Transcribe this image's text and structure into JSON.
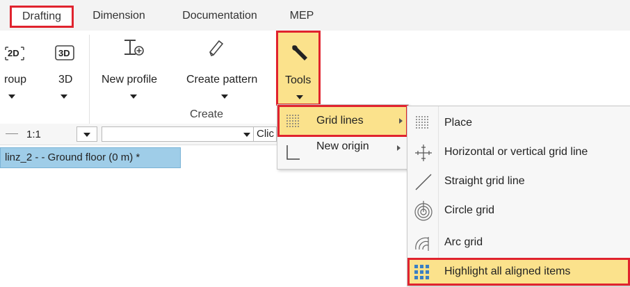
{
  "tabs": [
    "Drafting",
    "Dimension",
    "Documentation",
    "MEP"
  ],
  "ribbon": {
    "left_icon_label": "2D",
    "button_3d_icon": "3D",
    "group_label": "roup",
    "button_3d_label": "3D",
    "new_profile_label": "New profile",
    "create_pattern_label": "Create pattern",
    "tools_label": "Tools",
    "create_group_label": "Create"
  },
  "toolbar": {
    "scale_value": "1:1",
    "click_label": "Clic"
  },
  "document_tab": "linz_2 -  - Ground floor (0 m) *",
  "tools_menu": {
    "items": [
      {
        "label": "Grid lines",
        "icon": "grid-dots-icon"
      },
      {
        "label": "New origin",
        "icon": "origin-corner-icon"
      }
    ]
  },
  "grid_submenu": {
    "items": [
      {
        "label": "Place",
        "icon": "grid-dots-icon"
      },
      {
        "label": "Horizontal or vertical grid line",
        "icon": "crosshair-icon"
      },
      {
        "label": "Straight grid line",
        "icon": "diagonal-line-icon"
      },
      {
        "label": "Circle grid",
        "icon": "circle-grid-icon"
      },
      {
        "label": "Arc grid",
        "icon": "arc-grid-icon"
      },
      {
        "label": "Highlight all aligned items",
        "icon": "highlight-grid-icon"
      }
    ]
  },
  "colors": {
    "highlight": "#fbe28c",
    "callout": "#e0232e",
    "doc_tab": "#9fcde8",
    "icon_blue": "#3a7fc4"
  }
}
